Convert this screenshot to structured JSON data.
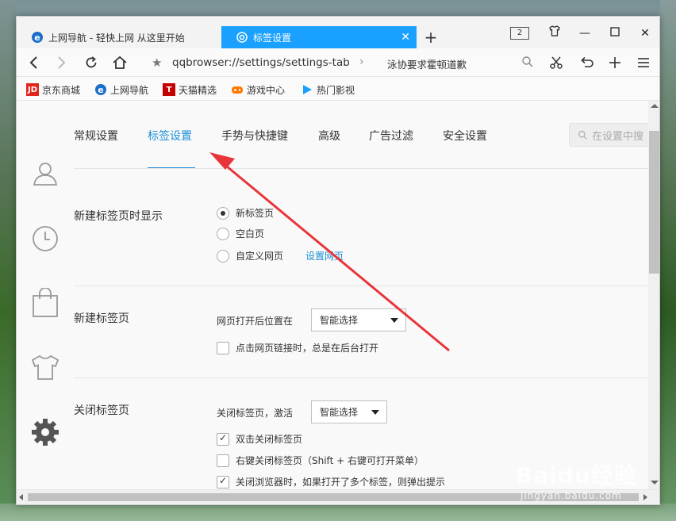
{
  "tabs": [
    {
      "label": "上网导航 - 轻快上网 从这里开始",
      "active": false
    },
    {
      "label": "标签设置",
      "active": true
    }
  ],
  "tab_counter": "2",
  "address": {
    "url": "qqbrowser://settings/settings-tab",
    "search_text": "泳协要求霍顿道歉"
  },
  "bookmarks": [
    {
      "label": "京东商城",
      "icon": "jd-icon",
      "icon_text": "JD",
      "color": "#e1251b"
    },
    {
      "label": "上网导航",
      "icon": "ie-icon",
      "icon_text": "e",
      "color": "#1a6fc9"
    },
    {
      "label": "天猫精选",
      "icon": "tmall-icon",
      "icon_text": "T",
      "color": "#c40000"
    },
    {
      "label": "游戏中心",
      "icon": "gamepad-icon",
      "icon_text": "",
      "color": "#ff7a00"
    },
    {
      "label": "热门影视",
      "icon": "video-play-icon",
      "icon_text": "",
      "color": "#1aa1ff"
    }
  ],
  "settings_nav": {
    "tabs": [
      "常规设置",
      "标签设置",
      "手势与快捷键",
      "高级",
      "广告过滤",
      "安全设置"
    ],
    "active_index": 1,
    "search_placeholder": "在设置中搜"
  },
  "sections": {
    "new_tab_display": {
      "title": "新建标签页时显示",
      "options": [
        "新标签页",
        "空白页",
        "自定义网页"
      ],
      "selected_index": 0,
      "link": "设置网页"
    },
    "new_tab": {
      "title": "新建标签页",
      "position_label": "网页打开后位置在",
      "position_value": "智能选择",
      "checkbox_label": "点击网页链接时，总是在后台打开",
      "checkbox_checked": false
    },
    "close_tab": {
      "title": "关闭标签页",
      "activate_label": "关闭标签页，激活",
      "activate_value": "智能选择",
      "checkboxes": [
        {
          "label": "双击关闭标签页",
          "checked": true
        },
        {
          "label": "右键关闭标签页（Shift + 右键可打开菜单）",
          "checked": false
        },
        {
          "label": "关闭浏览器时，如果打开了多个标签，则弹出提示",
          "checked": true
        }
      ]
    }
  },
  "watermark": {
    "main": "Baidu经验",
    "sub": "jingyan.baidu.com"
  },
  "colors": {
    "accent": "#1a8fd8",
    "active_tab": "#1aa1ff",
    "arrow": "#e8353a"
  }
}
